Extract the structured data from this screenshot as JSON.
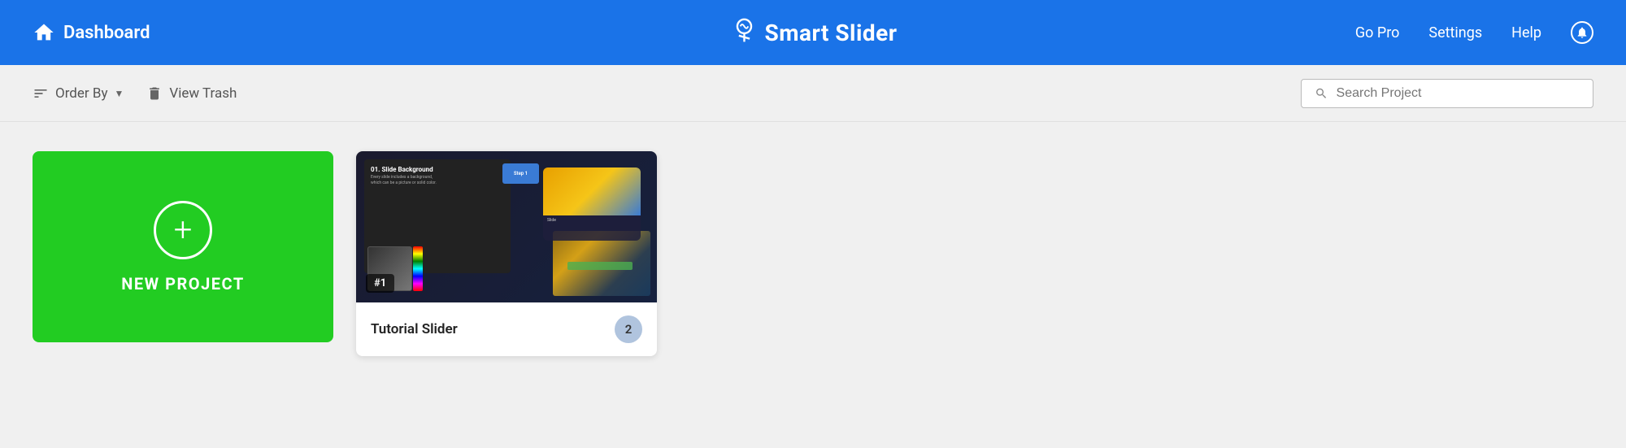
{
  "header": {
    "dashboard_label": "Dashboard",
    "logo_text": "Smart Slider",
    "go_pro_label": "Go Pro",
    "settings_label": "Settings",
    "help_label": "Help"
  },
  "toolbar": {
    "order_by_label": "Order By",
    "view_trash_label": "View Trash",
    "search_placeholder": "Search Project"
  },
  "new_project": {
    "label": "NEW PROJECT"
  },
  "projects": [
    {
      "id": "1",
      "name": "Tutorial Slider",
      "slide_count": "2",
      "badge": "#1"
    }
  ]
}
